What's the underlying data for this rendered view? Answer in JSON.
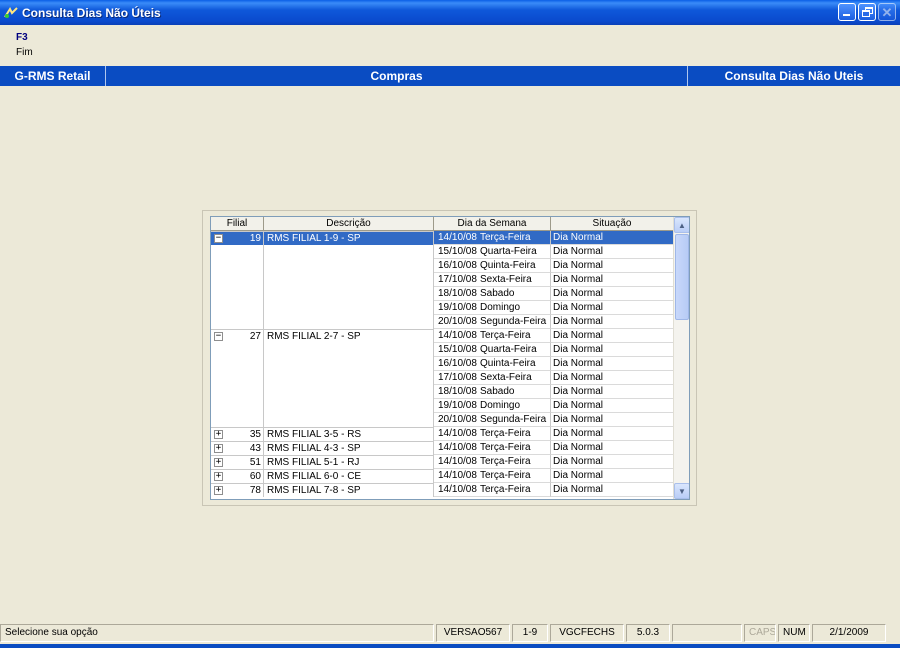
{
  "window": {
    "title": "Consulta Dias Não Úteis"
  },
  "hotkeys": [
    {
      "key": "F3",
      "label": "Fim"
    }
  ],
  "header": {
    "app": "G-RMS Retail",
    "module": "Compras",
    "screen": "Consulta Dias Não Uteis"
  },
  "grid": {
    "columns": [
      "Filial",
      "Descrição",
      "Dia da Semana",
      "Situação"
    ],
    "rows": [
      {
        "filial": "19",
        "desc": "RMS FILIAL 1-9 - SP",
        "date": "14/10/08",
        "weekday": "Terça-Feira",
        "situacao": "Dia Normal",
        "expander": "−",
        "selected": true
      },
      {
        "filial": "",
        "desc": "",
        "date": "15/10/08",
        "weekday": "Quarta-Feira",
        "situacao": "Dia Normal",
        "expander": "",
        "selected": false
      },
      {
        "filial": "",
        "desc": "",
        "date": "16/10/08",
        "weekday": "Quinta-Feira",
        "situacao": "Dia Normal",
        "expander": "",
        "selected": false
      },
      {
        "filial": "",
        "desc": "",
        "date": "17/10/08",
        "weekday": "Sexta-Feira",
        "situacao": "Dia Normal",
        "expander": "",
        "selected": false
      },
      {
        "filial": "",
        "desc": "",
        "date": "18/10/08",
        "weekday": "Sabado",
        "situacao": "Dia Normal",
        "expander": "",
        "selected": false
      },
      {
        "filial": "",
        "desc": "",
        "date": "19/10/08",
        "weekday": "Domingo",
        "situacao": "Dia Normal",
        "expander": "",
        "selected": false
      },
      {
        "filial": "",
        "desc": "",
        "date": "20/10/08",
        "weekday": "Segunda-Feira",
        "situacao": "Dia Normal",
        "expander": "",
        "selected": false
      },
      {
        "filial": "27",
        "desc": "RMS FILIAL 2-7 - SP",
        "date": "14/10/08",
        "weekday": "Terça-Feira",
        "situacao": "Dia Normal",
        "expander": "−",
        "selected": false
      },
      {
        "filial": "",
        "desc": "",
        "date": "15/10/08",
        "weekday": "Quarta-Feira",
        "situacao": "Dia Normal",
        "expander": "",
        "selected": false
      },
      {
        "filial": "",
        "desc": "",
        "date": "16/10/08",
        "weekday": "Quinta-Feira",
        "situacao": "Dia Normal",
        "expander": "",
        "selected": false
      },
      {
        "filial": "",
        "desc": "",
        "date": "17/10/08",
        "weekday": "Sexta-Feira",
        "situacao": "Dia Normal",
        "expander": "",
        "selected": false
      },
      {
        "filial": "",
        "desc": "",
        "date": "18/10/08",
        "weekday": "Sabado",
        "situacao": "Dia Normal",
        "expander": "",
        "selected": false
      },
      {
        "filial": "",
        "desc": "",
        "date": "19/10/08",
        "weekday": "Domingo",
        "situacao": "Dia Normal",
        "expander": "",
        "selected": false
      },
      {
        "filial": "",
        "desc": "",
        "date": "20/10/08",
        "weekday": "Segunda-Feira",
        "situacao": "Dia Normal",
        "expander": "",
        "selected": false
      },
      {
        "filial": "35",
        "desc": "RMS FILIAL 3-5 - RS",
        "date": "14/10/08",
        "weekday": "Terça-Feira",
        "situacao": "Dia Normal",
        "expander": "+",
        "selected": false
      },
      {
        "filial": "43",
        "desc": "RMS FILIAL 4-3 - SP",
        "date": "14/10/08",
        "weekday": "Terça-Feira",
        "situacao": "Dia Normal",
        "expander": "+",
        "selected": false
      },
      {
        "filial": "51",
        "desc": "RMS FILIAL 5-1 - RJ",
        "date": "14/10/08",
        "weekday": "Terça-Feira",
        "situacao": "Dia Normal",
        "expander": "+",
        "selected": false
      },
      {
        "filial": "60",
        "desc": "RMS FILIAL 6-0 - CE",
        "date": "14/10/08",
        "weekday": "Terça-Feira",
        "situacao": "Dia Normal",
        "expander": "+",
        "selected": false
      },
      {
        "filial": "78",
        "desc": "RMS FILIAL 7-8 - SP",
        "date": "14/10/08",
        "weekday": "Terça-Feira",
        "situacao": "Dia Normal",
        "expander": "+",
        "selected": false
      }
    ]
  },
  "statusbar": {
    "message": "Selecione sua opção",
    "version_label": "VERSAO567",
    "filial": "1-9",
    "program": "VGCFECHS",
    "release": "5.0.3",
    "caps": "CAPS",
    "num": "NUM",
    "date": "2/1/2009"
  },
  "colors": {
    "title_gradient": "#0A5EE6",
    "header_bar": "#0A4CC2",
    "selection": "#316AC5",
    "background": "#ECE9D8"
  },
  "icons": {
    "app": "app-logo-icon",
    "minimize": "minimize-icon",
    "maximize": "restore-icon",
    "close": "close-icon"
  }
}
